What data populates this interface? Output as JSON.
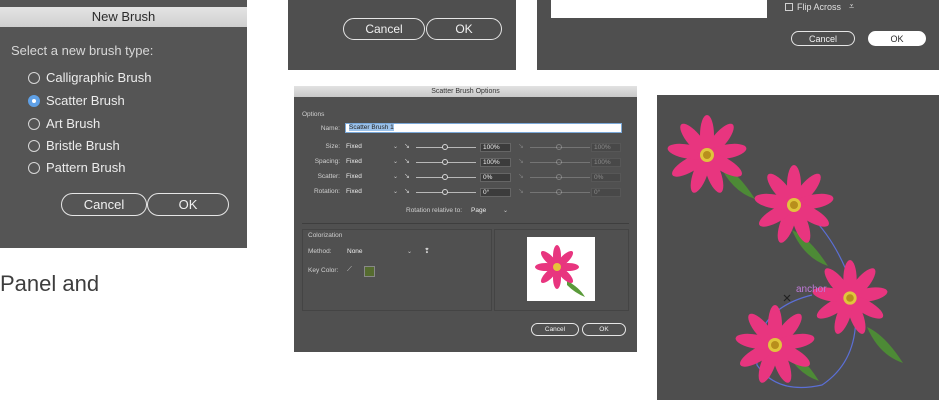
{
  "new_brush": {
    "title": "New Brush",
    "prompt": "Select a new brush type:",
    "options": [
      {
        "label": "Calligraphic Brush",
        "selected": false
      },
      {
        "label": "Scatter Brush",
        "selected": true
      },
      {
        "label": "Art Brush",
        "selected": false
      },
      {
        "label": "Bristle Brush",
        "selected": false
      },
      {
        "label": "Pattern Brush",
        "selected": false
      }
    ],
    "cancel": "Cancel",
    "ok": "OK"
  },
  "top_mid": {
    "cancel": "Cancel",
    "ok": "OK"
  },
  "top_right": {
    "flip_label": "Flip Across",
    "cancel": "Cancel",
    "ok": "OK"
  },
  "scatter_options": {
    "title": "Scatter Brush Options",
    "options_heading": "Options",
    "name_label": "Name:",
    "name_value": "Scatter Brush 1",
    "rows": [
      {
        "label": "Size:",
        "mode": "Fixed",
        "value": "100%",
        "value2": "100%"
      },
      {
        "label": "Spacing:",
        "mode": "Fixed",
        "value": "100%",
        "value2": "100%"
      },
      {
        "label": "Scatter:",
        "mode": "Fixed",
        "value": "0%",
        "value2": "0%"
      },
      {
        "label": "Rotation:",
        "mode": "Fixed",
        "value": "0°",
        "value2": "0°"
      }
    ],
    "rotation_relative_label": "Rotation relative to:",
    "rotation_relative_value": "Page",
    "colorization_heading": "Colorization",
    "method_label": "Method:",
    "method_value": "None",
    "key_color_label": "Key Color:",
    "key_color": "#556b2f",
    "cancel": "Cancel",
    "ok": "OK"
  },
  "canvas": {
    "anchor_label": "anchor"
  },
  "caption": "Panel and",
  "colors": {
    "accent": "#5fa0e6",
    "petal": "#e8357f",
    "path": "#5b6fd6"
  }
}
